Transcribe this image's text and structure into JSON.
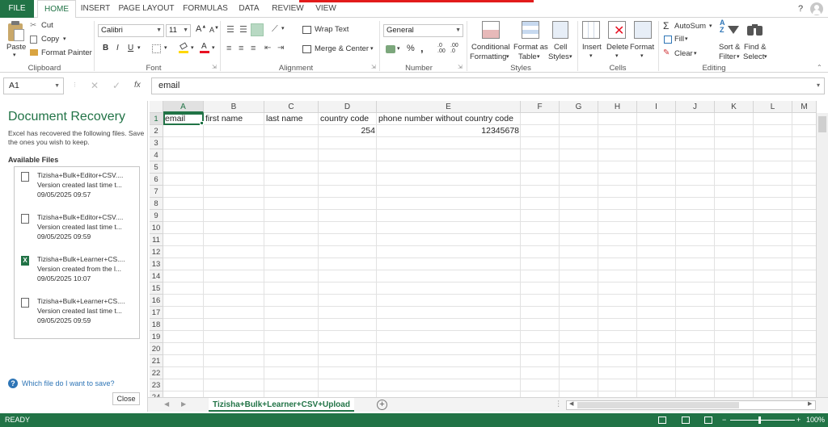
{
  "tabs": {
    "file": "FILE",
    "home": "HOME",
    "insert": "INSERT",
    "page_layout": "PAGE LAYOUT",
    "formulas": "FORMULAS",
    "data": "DATA",
    "review": "REVIEW",
    "view": "VIEW"
  },
  "window": {
    "help": "?"
  },
  "ribbon": {
    "clipboard": {
      "paste": "Paste",
      "cut": "Cut",
      "copy": "Copy",
      "format_painter": "Format Painter",
      "label": "Clipboard"
    },
    "font": {
      "name": "Calibri",
      "size": "11",
      "label": "Font",
      "bold": "B",
      "italic": "I",
      "underline": "U"
    },
    "alignment": {
      "wrap_text": "Wrap Text",
      "merge_center": "Merge & Center",
      "label": "Alignment"
    },
    "number": {
      "format": "General",
      "percent": "%",
      "comma": ",",
      "label": "Number"
    },
    "styles": {
      "conditional": "Conditional",
      "formatting": "Formatting",
      "format_as": "Format as",
      "table": "Table",
      "cell": "Cell",
      "styles_btn": "Styles",
      "label": "Styles"
    },
    "cells": {
      "insert": "Insert",
      "delete": "Delete",
      "format": "Format",
      "label": "Cells"
    },
    "editing": {
      "autosum": "AutoSum",
      "fill": "Fill",
      "clear": "Clear",
      "sort": "Sort &",
      "filter": "Filter",
      "find": "Find &",
      "select": "Select",
      "label": "Editing"
    }
  },
  "formula_bar": {
    "name_box": "A1",
    "fx": "fx",
    "value": "email"
  },
  "recovery": {
    "title": "Document Recovery",
    "description": "Excel has recovered the following files. Save the ones you wish to keep.",
    "available": "Available Files",
    "files": [
      {
        "name": "Tizisha+Bulk+Editor+CSV....",
        "version": "Version created last time t...",
        "date": "09/05/2025 09:57",
        "type": "doc"
      },
      {
        "name": "Tizisha+Bulk+Editor+CSV....",
        "version": "Version created last time t...",
        "date": "09/05/2025 09:59",
        "type": "doc"
      },
      {
        "name": "Tizisha+Bulk+Learner+CS....",
        "version": "Version created from the l...",
        "date": "09/05/2025 10:07",
        "type": "excel"
      },
      {
        "name": "Tizisha+Bulk+Learner+CS....",
        "version": "Version created last time t...",
        "date": "09/05/2025 09:59",
        "type": "doc"
      }
    ],
    "help": "Which file do I want to save?",
    "close": "Close"
  },
  "sheet": {
    "columns": [
      "A",
      "B",
      "C",
      "D",
      "E",
      "F",
      "G",
      "H",
      "I",
      "J",
      "K",
      "L",
      "M"
    ],
    "rows": [
      "1",
      "2",
      "3",
      "4",
      "5",
      "6",
      "7",
      "8",
      "9",
      "10",
      "11",
      "12",
      "13",
      "14",
      "15",
      "16",
      "17",
      "18",
      "19",
      "20",
      "21",
      "22",
      "23",
      "24"
    ],
    "row1": [
      "email",
      "first name",
      "last name",
      "country code",
      "phone number without country code"
    ],
    "row2_d": "254",
    "row2_e": "12345678"
  },
  "sheet_tab": "Tizisha+Bulk+Learner+CSV+Upload",
  "status": {
    "ready": "READY",
    "zoom": "100%"
  }
}
